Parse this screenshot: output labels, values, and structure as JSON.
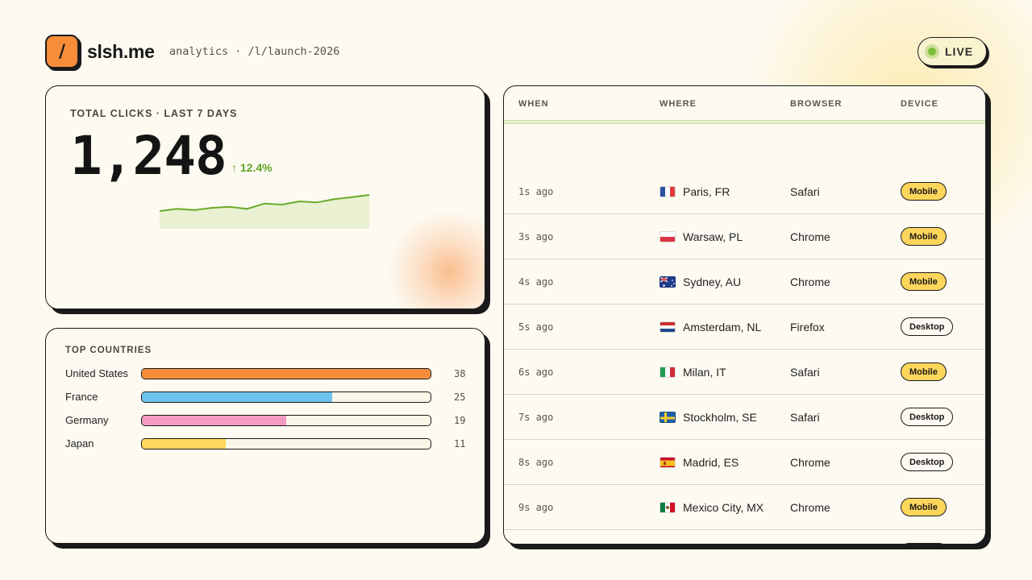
{
  "header": {
    "logo_glyph": "/",
    "brand": "slsh.me",
    "breadcrumb": "analytics · /l/launch-2026",
    "live_label": "LIVE"
  },
  "clicks_card": {
    "kicker": "TOTAL CLICKS · LAST 7 DAYS",
    "total": "1,248",
    "delta": "↑ 12.4%",
    "sparkline_values": [
      14,
      16,
      15,
      17,
      18,
      16,
      21,
      20,
      23,
      22,
      25,
      27,
      29
    ],
    "colors": {
      "line": "#6aab2a",
      "fill": "#e9f1d2",
      "glow": "#f78c3a"
    }
  },
  "countries_card": {
    "title": "TOP COUNTRIES",
    "max": 38,
    "items": [
      {
        "name": "United States",
        "count": "38",
        "value": 38,
        "color": "#f78c3a"
      },
      {
        "name": "France",
        "count": "25",
        "value": 25,
        "color": "#6ec4ec"
      },
      {
        "name": "Germany",
        "count": "19",
        "value": 19,
        "color": "#f49ac1"
      },
      {
        "name": "Japan",
        "count": "11",
        "value": 11,
        "color": "#ffd65c"
      }
    ]
  },
  "feed": {
    "columns": {
      "when": "WHEN",
      "where": "WHERE",
      "browser": "BROWSER",
      "device": "DEVICE"
    },
    "rows": [
      {
        "when": "1s ago",
        "where": "Paris, FR",
        "flag": "fr-flag-icon",
        "browser": "Safari",
        "device": "Mobile"
      },
      {
        "when": "3s ago",
        "where": "Warsaw, PL",
        "flag": "pl-flag-icon",
        "browser": "Chrome",
        "device": "Mobile"
      },
      {
        "when": "4s ago",
        "where": "Sydney, AU",
        "flag": "au-flag-icon",
        "browser": "Chrome",
        "device": "Mobile"
      },
      {
        "when": "5s ago",
        "where": "Amsterdam, NL",
        "flag": "nl-flag-icon",
        "browser": "Firefox",
        "device": "Desktop"
      },
      {
        "when": "6s ago",
        "where": "Milan, IT",
        "flag": "it-flag-icon",
        "browser": "Safari",
        "device": "Mobile"
      },
      {
        "when": "7s ago",
        "where": "Stockholm, SE",
        "flag": "se-flag-icon",
        "browser": "Safari",
        "device": "Desktop"
      },
      {
        "when": "8s ago",
        "where": "Madrid, ES",
        "flag": "es-flag-icon",
        "browser": "Chrome",
        "device": "Desktop"
      },
      {
        "when": "9s ago",
        "where": "Mexico City, MX",
        "flag": "mx-flag-icon",
        "browser": "Chrome",
        "device": "Mobile"
      }
    ],
    "colors": {
      "mobile": "#ffd65c",
      "desktop": "#fdfaf1",
      "accent": "#e6f0cf"
    }
  }
}
